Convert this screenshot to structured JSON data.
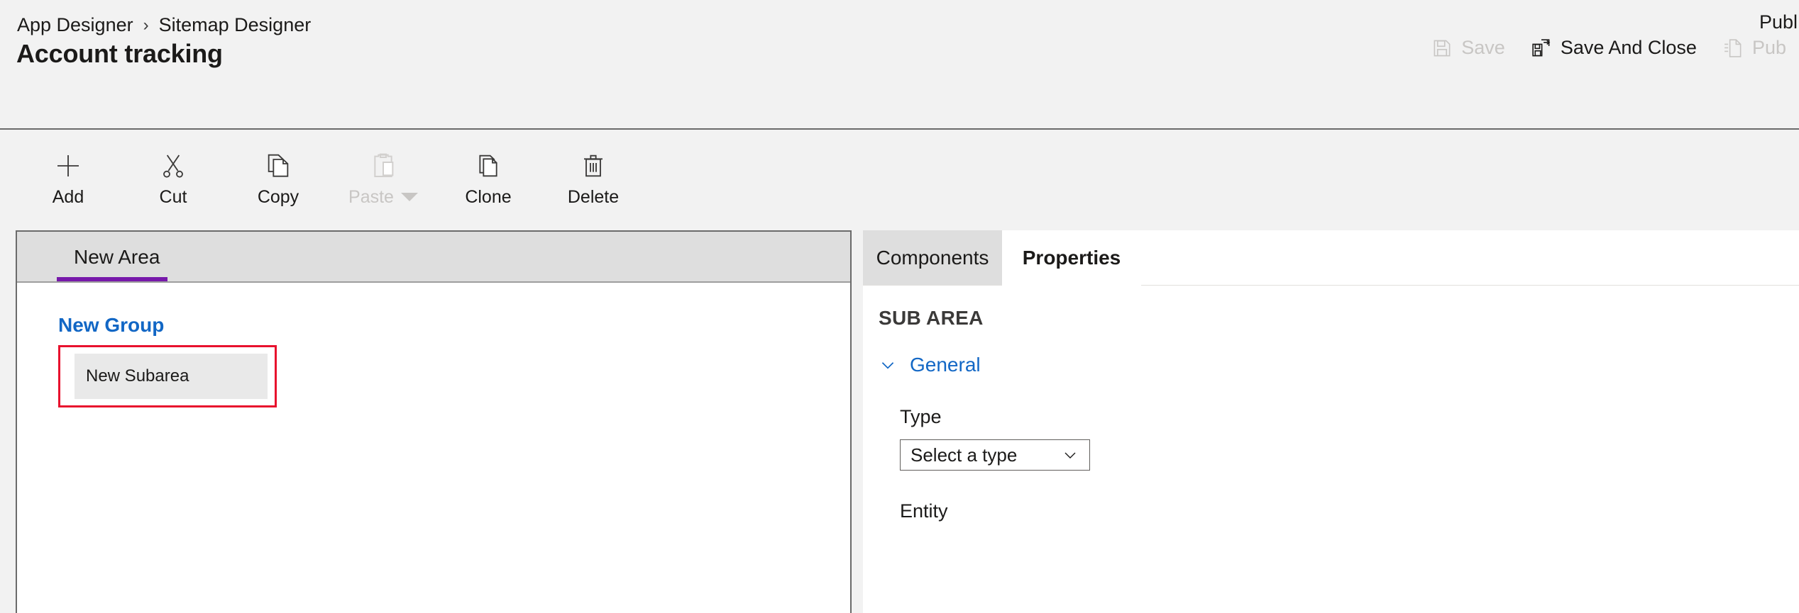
{
  "header": {
    "breadcrumb": [
      "App Designer",
      "Sitemap Designer"
    ],
    "separator": "›",
    "title": "Account tracking",
    "publish_status_text": "Publ",
    "commands": [
      {
        "label": "Save",
        "icon": "save-icon",
        "disabled": true
      },
      {
        "label": "Save And Close",
        "icon": "save-and-close-icon",
        "disabled": false
      },
      {
        "label": "Pub",
        "icon": "publish-icon",
        "disabled": true
      }
    ]
  },
  "toolbar": {
    "items": [
      {
        "label": "Add",
        "icon": "add-icon",
        "disabled": false,
        "has_caret": false
      },
      {
        "label": "Cut",
        "icon": "cut-icon",
        "disabled": false,
        "has_caret": false
      },
      {
        "label": "Copy",
        "icon": "copy-icon",
        "disabled": false,
        "has_caret": false
      },
      {
        "label": "Paste",
        "icon": "paste-icon",
        "disabled": true,
        "has_caret": true
      },
      {
        "label": "Clone",
        "icon": "clone-icon",
        "disabled": false,
        "has_caret": false
      },
      {
        "label": "Delete",
        "icon": "delete-icon",
        "disabled": false,
        "has_caret": false
      }
    ]
  },
  "canvas": {
    "area_tab": "New Area",
    "group_title": "New Group",
    "subarea_label": "New Subarea",
    "selection_color": "#e8112d",
    "tab_accent_color": "#7719aa",
    "group_link_color": "#1267c5"
  },
  "panel": {
    "tabs": [
      {
        "label": "Components",
        "active": false
      },
      {
        "label": "Properties",
        "active": true
      }
    ],
    "section_heading": "SUB AREA",
    "group_label": "General",
    "group_expanded": true,
    "fields": [
      {
        "label": "Type",
        "value": "Select a type",
        "control": "dropdown"
      },
      {
        "label": "Entity",
        "value": "",
        "control": "dropdown"
      }
    ]
  }
}
